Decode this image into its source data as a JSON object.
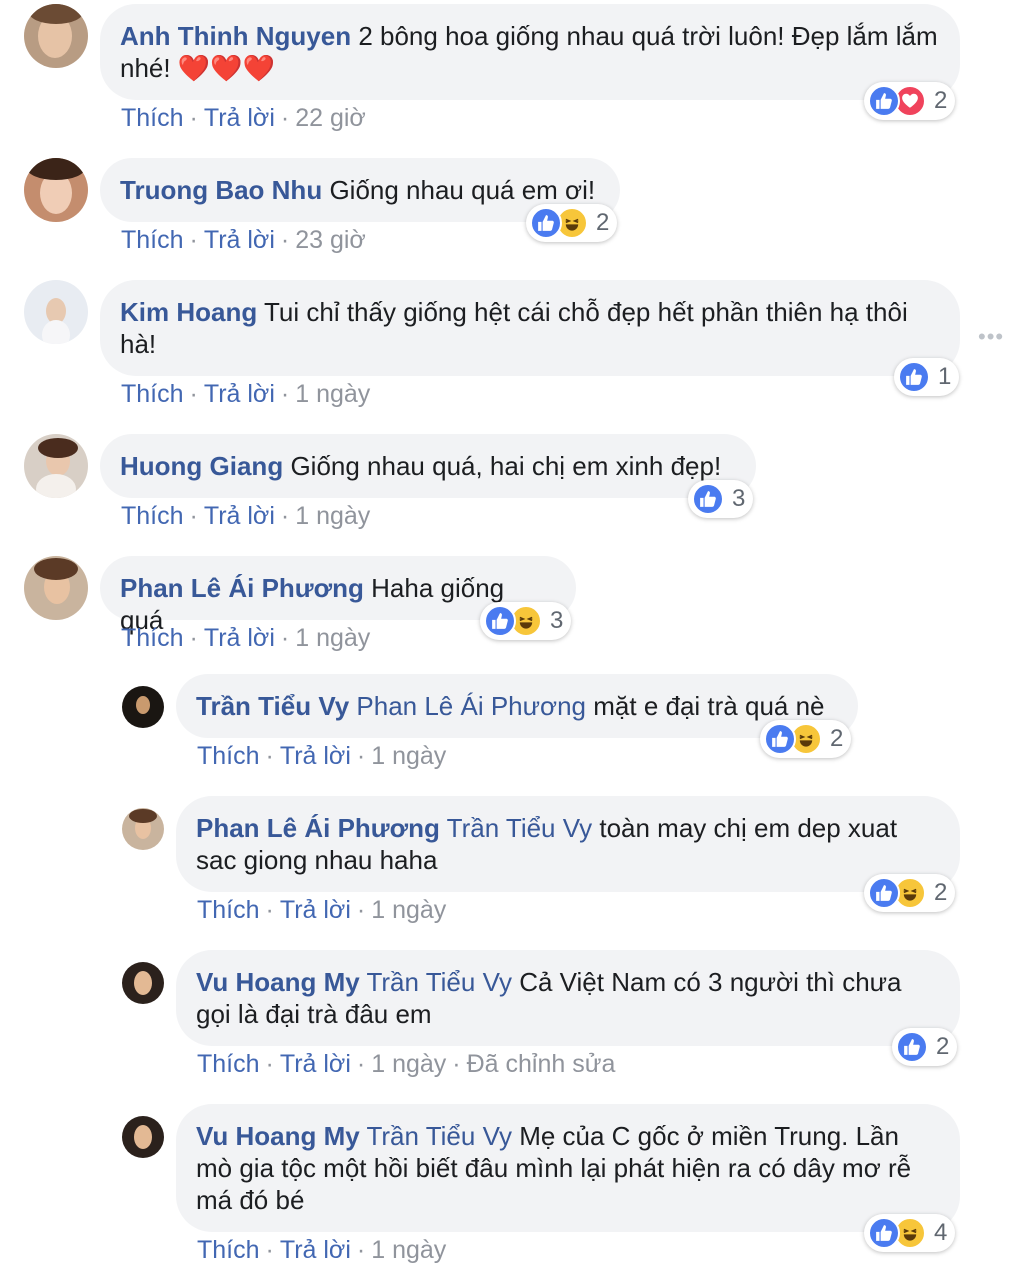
{
  "labels": {
    "like": "Thích",
    "reply": "Trả lời",
    "more": "•••"
  },
  "comments": [
    {
      "author": "Anh Thinh Nguyen",
      "tag": "",
      "text": "2 bông hoa giống nhau quá trời luôn! Đẹp lắm lắm nhé! ❤️❤️❤️",
      "time": "22 giờ",
      "edited": "",
      "reactions": [
        "like",
        "love"
      ],
      "count": "2"
    },
    {
      "author": "Truong Bao Nhu",
      "tag": "",
      "text": "Giống nhau quá em ơi!",
      "time": "23 giờ",
      "edited": "",
      "reactions": [
        "like",
        "haha"
      ],
      "count": "2"
    },
    {
      "author": "Kim Hoang",
      "tag": "",
      "text": "Tui chỉ thấy giống hệt cái chỗ đẹp hết phần thiên hạ thôi hà!",
      "time": "1 ngày",
      "edited": "",
      "reactions": [
        "like"
      ],
      "count": "1"
    },
    {
      "author": "Huong Giang",
      "tag": "",
      "text": "Giống nhau quá, hai chị em xinh đẹp!",
      "time": "1 ngày",
      "edited": "",
      "reactions": [
        "like"
      ],
      "count": "3"
    },
    {
      "author": "Phan Lê Ái Phương",
      "tag": "",
      "text": "Haha giống quá",
      "time": "1 ngày",
      "edited": "",
      "reactions": [
        "like",
        "haha"
      ],
      "count": "3"
    },
    {
      "author": "Trần Tiểu Vy",
      "tag": "Phan Lê Ái Phương",
      "text": "mặt e đại trà quá nè",
      "time": "1 ngày",
      "edited": "",
      "reactions": [
        "like",
        "haha"
      ],
      "count": "2"
    },
    {
      "author": "Phan Lê Ái Phương",
      "tag": "Trần Tiểu Vy",
      "text": "toàn may chị em dep xuat sac giong nhau haha",
      "time": "1 ngày",
      "edited": "",
      "reactions": [
        "like",
        "haha"
      ],
      "count": "2"
    },
    {
      "author": "Vu Hoang My",
      "tag": "Trần Tiểu Vy",
      "text": "Cả Việt Nam có 3 người thì chưa gọi là đại trà đâu em",
      "time": "1 ngày",
      "edited": "Đã chỉnh sửa",
      "reactions": [
        "like"
      ],
      "count": "2"
    },
    {
      "author": "Vu Hoang My",
      "tag": "Trần Tiểu Vy",
      "text": "Mẹ của C gốc ở miền Trung. Lần mò gia tộc một hồi biết đâu mình lại phát hiện ra có dây mơ rễ má đó bé",
      "time": "1 ngày",
      "edited": "",
      "reactions": [
        "like",
        "haha"
      ],
      "count": "4"
    }
  ],
  "colors": {
    "author": "#385898",
    "action": "#4267b2",
    "bubble": "#f2f3f5",
    "like": "#4a7bf0",
    "love": "#f0435c",
    "haha": "#f7c63a"
  }
}
